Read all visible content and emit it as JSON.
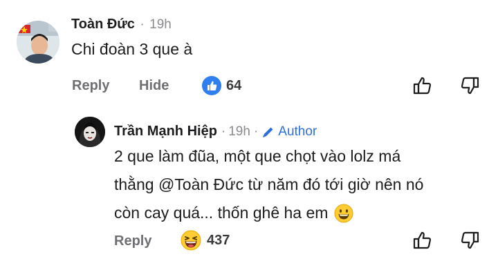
{
  "comment": {
    "author": "Toàn Đức",
    "separator": "·",
    "time": "19h",
    "text": "Chi đoàn 3 que à",
    "actions": {
      "reply": "Reply",
      "hide": "Hide"
    },
    "reaction_count": "64",
    "reaction_icon": "like-icon",
    "colors": {
      "like_blue": "#2f7ff0"
    }
  },
  "reply": {
    "author": "Trần Mạnh Hiệp",
    "separator1": "·",
    "time": "19h",
    "separator2": "·",
    "author_badge": "Author",
    "badge_icon": "pencil-icon",
    "text_lines": [
      "2 que làm đũa, một que chọt vào lolz má",
      "thằng @Toàn Đức từ năm đó tới giờ nên nó",
      "còn cay quá... thốn ghê ha em"
    ],
    "inline_emoji": "😀",
    "actions": {
      "reply": "Reply"
    },
    "reaction_count": "437",
    "reaction_icon": "laughing-emoji-icon",
    "colors": {
      "badge_blue": "#2a6fdb"
    }
  }
}
